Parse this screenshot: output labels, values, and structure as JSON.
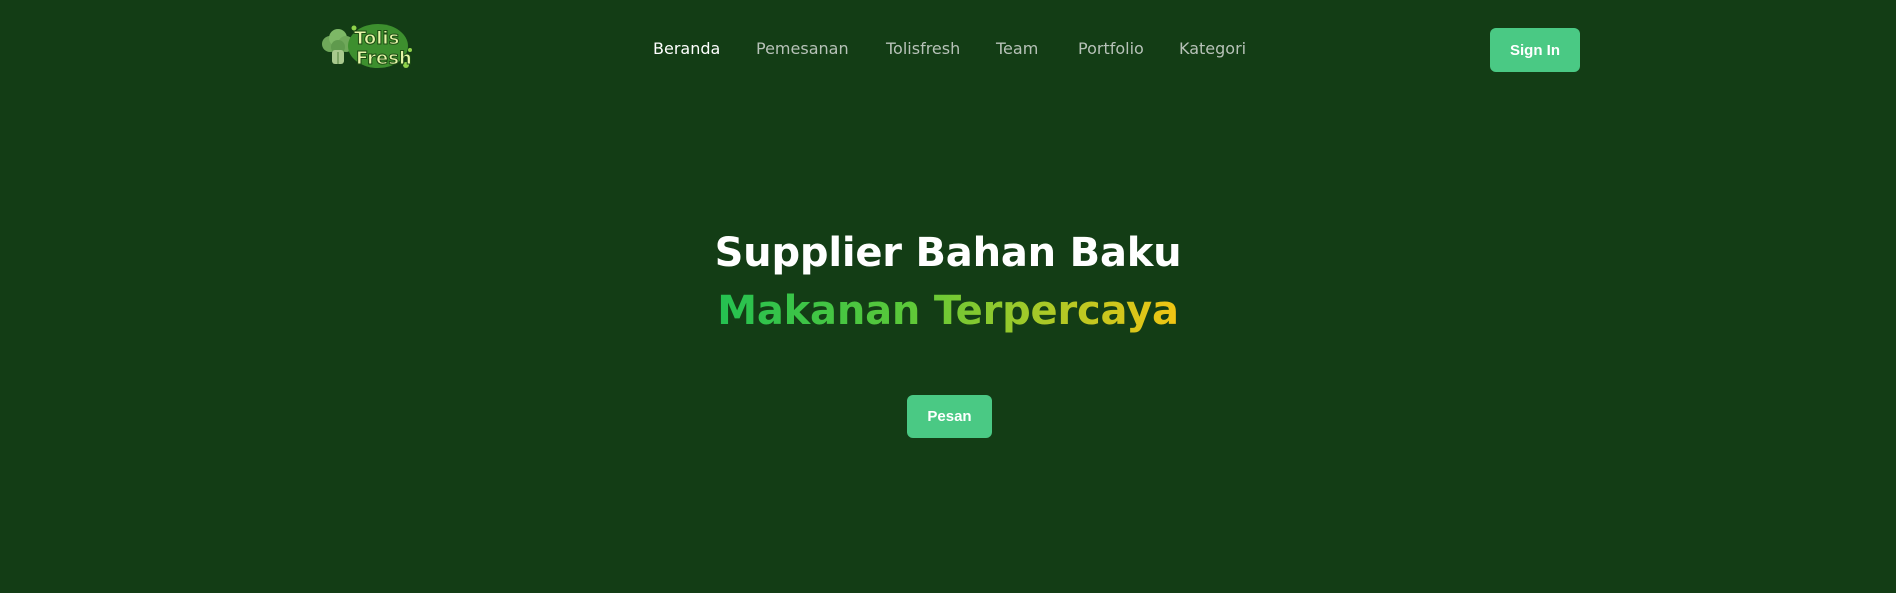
{
  "logo": {
    "text_line1": "Tolis",
    "text_line2": "Fresh",
    "icon": "broccoli-icon"
  },
  "nav": {
    "items": [
      {
        "label": "Beranda",
        "active": true
      },
      {
        "label": "Pemesanan",
        "active": false
      },
      {
        "label": "Tolisfresh",
        "active": false
      },
      {
        "label": "Team",
        "active": false
      },
      {
        "label": "Portfolio",
        "active": false
      },
      {
        "label": "Kategori",
        "active": false
      }
    ]
  },
  "header": {
    "signin_label": "Sign In"
  },
  "hero": {
    "line1": "Supplier Bahan Baku",
    "line2": "Makanan Terpercaya",
    "cta_label": "Pesan"
  },
  "colors": {
    "background": "#133d15",
    "accent_button": "#4ac984",
    "gradient_start": "#24c151",
    "gradient_end": "#f2c513",
    "nav_text": "#b7c2b8",
    "nav_active": "#ffffff"
  }
}
